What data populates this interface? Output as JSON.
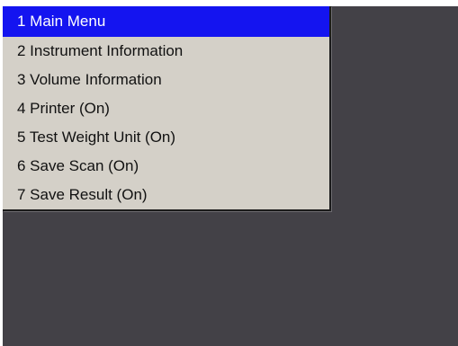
{
  "menu": {
    "items": [
      {
        "label": "1 Main Menu",
        "selected": true
      },
      {
        "label": "2 Instrument Information",
        "selected": false
      },
      {
        "label": "3 Volume Information",
        "selected": false
      },
      {
        "label": "4 Printer (On)",
        "selected": false
      },
      {
        "label": "5 Test Weight Unit (On)",
        "selected": false
      },
      {
        "label": "6 Save Scan (On)",
        "selected": false
      },
      {
        "label": "7 Save Result (On)",
        "selected": false
      }
    ]
  },
  "colors": {
    "screen_background": "#434147",
    "menu_background": "#d4d0c8",
    "selected_background": "#1414f0",
    "selected_text": "#ffffff",
    "menu_text": "#111111"
  }
}
